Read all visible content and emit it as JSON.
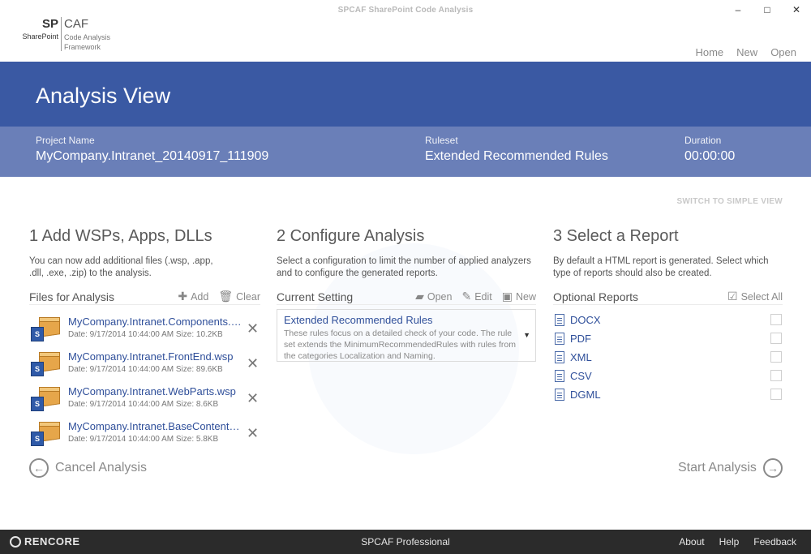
{
  "window": {
    "title": "SPCAF SharePoint Code Analysis",
    "controls": [
      "–",
      "□",
      "✕"
    ]
  },
  "logo": {
    "sp": "SP",
    "sp_sub": "SharePoint",
    "caf": "CAF",
    "caf_sub": "Code Analysis Framework"
  },
  "topnav": {
    "home": "Home",
    "new": "New",
    "open": "Open"
  },
  "banner": {
    "title": "Analysis View"
  },
  "info": {
    "project_label": "Project Name",
    "project_value": "MyCompany.Intranet_20140917_111909",
    "ruleset_label": "Ruleset",
    "ruleset_value": "Extended Recommended Rules",
    "duration_label": "Duration",
    "duration_value": "00:00:00"
  },
  "simple_view": "SWITCH TO SIMPLE VIEW",
  "step1": {
    "title": "1 Add WSPs, Apps, DLLs",
    "desc": "You can now add additional files (.wsp, .app, .dll, .exe, .zip) to the analysis.",
    "files_label": "Files for Analysis",
    "add_label": "Add",
    "clear_label": "Clear",
    "files": [
      {
        "name": "MyCompany.Intranet.Components.wsp",
        "meta": "Date: 9/17/2014 10:44:00 AM Size: 10.2KB"
      },
      {
        "name": "MyCompany.Intranet.FrontEnd.wsp",
        "meta": "Date: 9/17/2014 10:44:00 AM Size: 89.6KB"
      },
      {
        "name": "MyCompany.Intranet.WebParts.wsp",
        "meta": "Date: 9/17/2014 10:44:00 AM Size: 8.6KB"
      },
      {
        "name": "MyCompany.Intranet.BaseContentTy...",
        "meta": "Date: 9/17/2014 10:44:00 AM Size: 5.8KB"
      }
    ]
  },
  "step2": {
    "title": "2 Configure Analysis",
    "desc": "Select a configuration to limit the number of applied analyzers and to configure the generated reports.",
    "current_label": "Current Setting",
    "open_label": "Open",
    "edit_label": "Edit",
    "new_label": "New",
    "setting_name": "Extended Recommended Rules",
    "setting_desc": "These rules focus on a detailed check of your code. The rule set extends the MinimumRecommendedRules with rules from the categories Localization and Naming."
  },
  "step3": {
    "title": "3 Select a Report",
    "desc": "By default a HTML report is generated. Select which type of reports should also be created.",
    "optional_label": "Optional Reports",
    "select_all_label": "Select All",
    "reports": [
      "DOCX",
      "PDF",
      "XML",
      "CSV",
      "DGML"
    ]
  },
  "actions": {
    "cancel": "Cancel Analysis",
    "start": "Start Analysis"
  },
  "footer": {
    "brand": "RENCORE",
    "edition": "SPCAF Professional",
    "about": "About",
    "help": "Help",
    "feedback": "Feedback"
  },
  "colors": {
    "banner": "#3a59a3",
    "infobar": "#6a7fb8",
    "link": "#2f4f9a",
    "footer": "#2b2b2b"
  }
}
